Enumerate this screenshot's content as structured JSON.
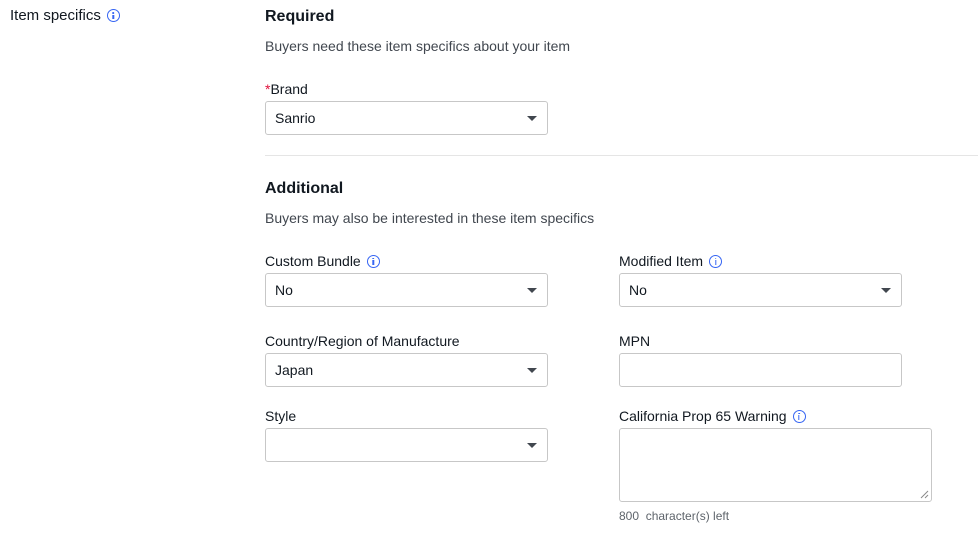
{
  "section": {
    "label": "Item specifics",
    "info_icon": "info-icon"
  },
  "required": {
    "heading": "Required",
    "description": "Buyers need these item specifics about your item",
    "brand": {
      "required_marker": "*",
      "label": "Brand",
      "value": "Sanrio"
    }
  },
  "additional": {
    "heading": "Additional",
    "description": "Buyers may also be interested in these item specifics",
    "custom_bundle": {
      "label": "Custom Bundle",
      "value": "No",
      "icon": "info-icon"
    },
    "modified_item": {
      "label": "Modified Item",
      "value": "No",
      "icon": "info-icon"
    },
    "country": {
      "label": "Country/Region of Manufacture",
      "value": "Japan"
    },
    "mpn": {
      "label": "MPN",
      "value": ""
    },
    "style": {
      "label": "Style",
      "value": ""
    },
    "prop65": {
      "label": "California Prop 65 Warning",
      "value": "",
      "icon": "info-icon",
      "counter_number": "800",
      "counter_text": "character(s) left"
    }
  },
  "colors": {
    "accent": "#3665f3",
    "required_star": "#e0103a",
    "border": "#c7c7c7",
    "text": "#111820"
  }
}
